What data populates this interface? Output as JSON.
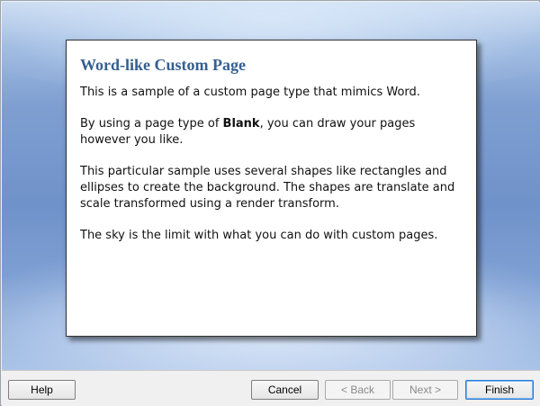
{
  "page": {
    "title": "Word-like Custom Page",
    "paragraphs": [
      {
        "text": "This is a sample of a custom page type that mimics Word."
      },
      {
        "prefix": "By using a page type of ",
        "bold": "Blank",
        "suffix": ", you can draw your pages however you like."
      },
      {
        "text": "This particular sample uses several shapes like rectangles and ellipses to create the background. The shapes are translate and scale transformed using a render transform."
      },
      {
        "text": "The sky is the limit with what you can do with custom pages."
      }
    ]
  },
  "footer": {
    "help_label": "Help",
    "cancel_label": "Cancel",
    "back_label": "< Back",
    "next_label": "Next >",
    "finish_label": "Finish"
  },
  "colors": {
    "title": "#365f91",
    "accent_focus": "#2a7bd6"
  }
}
